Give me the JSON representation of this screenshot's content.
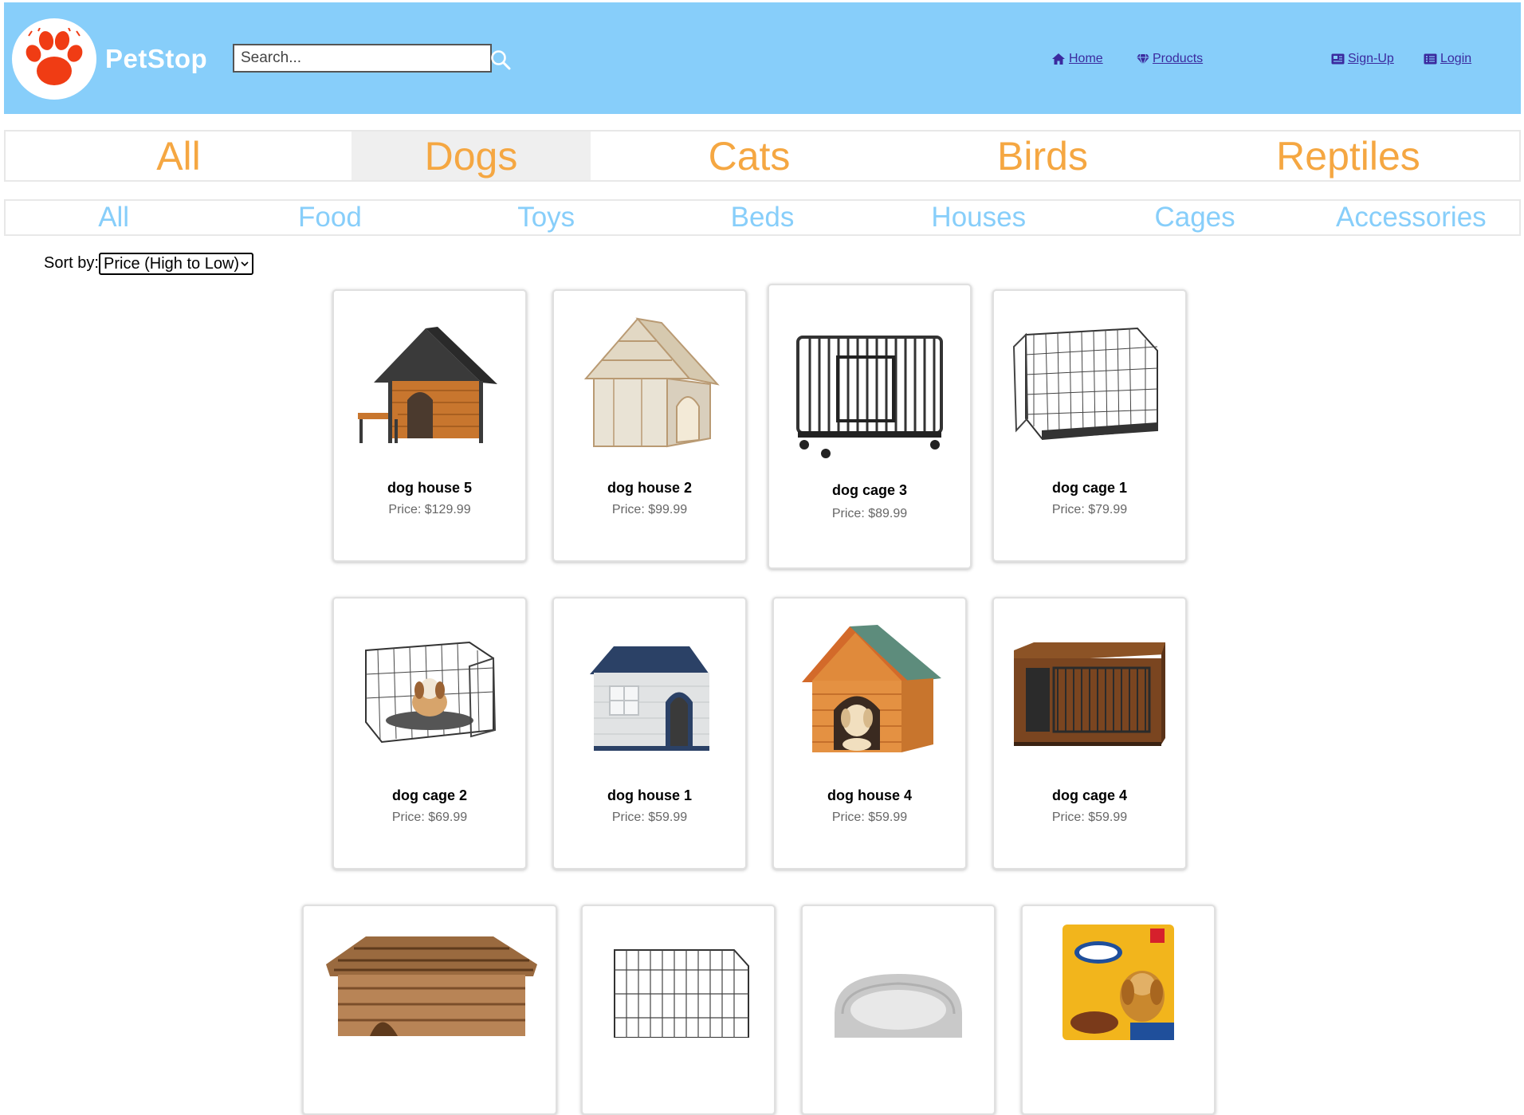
{
  "brand": {
    "name": "PetStop"
  },
  "search": {
    "placeholder": "Search..."
  },
  "nav": {
    "home": "Home",
    "products": "Products",
    "signup": "Sign-Up",
    "login": "Login"
  },
  "pet_tabs": [
    "All",
    "Dogs",
    "Cats",
    "Birds",
    "Reptiles"
  ],
  "pet_tab_active": "Dogs",
  "category_tabs": [
    "All",
    "Food",
    "Toys",
    "Beds",
    "Houses",
    "Cages",
    "Accessories"
  ],
  "sort": {
    "label": "Sort by:",
    "selected": "Price (High to Low)"
  },
  "products": [
    {
      "name": "dog house 5",
      "price": "Price: $129.99"
    },
    {
      "name": "dog house 2",
      "price": "Price: $99.99"
    },
    {
      "name": "dog cage 3",
      "price": "Price: $89.99"
    },
    {
      "name": "dog cage 1",
      "price": "Price: $79.99"
    },
    {
      "name": "dog cage 2",
      "price": "Price: $69.99"
    },
    {
      "name": "dog house 1",
      "price": "Price: $59.99"
    },
    {
      "name": "dog house 4",
      "price": "Price: $59.99"
    },
    {
      "name": "dog cage 4",
      "price": "Price: $59.99"
    }
  ],
  "colors": {
    "header": "#87cefa",
    "pet_tab_text": "#f5a742",
    "category_text": "#87cefa",
    "logo_paw": "#f03c14",
    "nav_link": "#3b2a9e"
  }
}
